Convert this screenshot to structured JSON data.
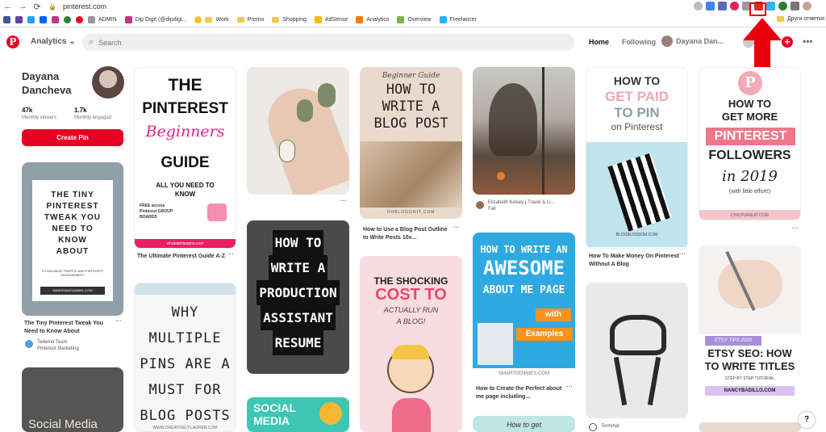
{
  "browser": {
    "url": "pinterest.com",
    "bookmarks": [
      "ADMIN",
      "Dip Digit (@dipdigi...",
      "Work",
      "Promo",
      "Shopping",
      "AdSense",
      "Analytics",
      "Overview",
      "Freelancer"
    ],
    "other_bookmarks": "Други отметки"
  },
  "header": {
    "analytics_label": "Analytics",
    "search_placeholder": "Search",
    "home_label": "Home",
    "following_label": "Following",
    "user_name": "Dayana Dan..."
  },
  "profile": {
    "name_line1": "Dayana",
    "name_line2": "Dancheva",
    "viewers_value": "47k",
    "viewers_label": "Monthly viewers",
    "engaged_value": "1.7k",
    "engaged_label": "Monthly engaged",
    "create_pin_label": "Create Pin"
  },
  "pins": {
    "p1": {
      "l1": "THE TINY",
      "l2": "PINTEREST",
      "l3": "TWEAK YOU",
      "l4": "NEED TO",
      "l5": "KNOW",
      "l6": "ABOUT",
      "sub": "TO MAXIMIZE TRAFFIC AND PINTEREST ENGAGEMENT!",
      "foot": "MARISSAMCDANIEL.COM",
      "title": "The Tiny Pinterest Tweak You Need to Know About",
      "src_name": "Tailwind Team",
      "src_sub": "Pinterest Marketing"
    },
    "p2": {
      "l1": "THE",
      "l2": "PINTEREST",
      "l3": "Beginners",
      "l4": "GUIDE",
      "l5": "ALL YOU NEED TO",
      "l6": "KNOW",
      "l7": "FREE access",
      "l8": "Pinterest GROUP",
      "l9": "BOARDS",
      "foot": "whatsbetterpins.com",
      "title": "The Ultimate Pinterest Guide A-Z"
    },
    "p3": {
      "l1": "WHY",
      "l2": "MULTIPLE",
      "l3": "PINS ARE A",
      "l4": "MUST FOR",
      "l5": "BLOG POSTS",
      "foot": "WWW.CREATIVELY-LAUREN.COM"
    },
    "p4": {
      "l1": "HOW TO",
      "l2": "WRITE A",
      "l3": "PRODUCTION",
      "l4": "ASSISTANT",
      "l5": "RESUME"
    },
    "p5": {
      "l1": "SOCIAL",
      "l2": "MEDIA"
    },
    "p6": {
      "l1": "Beginner Guide",
      "l2": "HOW TO",
      "l3": "WRITE A",
      "l4": "BLOG POST",
      "foot": "OHBLOGONIT.COM",
      "title": "How to Use a Blog Post Outline to Write Posts 10x..."
    },
    "p7": {
      "l1": "THE SHOCKING",
      "l2": "COST TO",
      "l3": "ACTUALLY RUN",
      "l4": "A BLOG!"
    },
    "p8": {
      "src_name": "Elizabeth Kelsey | Travel & Li...",
      "src_sub": "Fall"
    },
    "p9": {
      "l1": "HOW TO WRITE AN",
      "l2": "AWESOME",
      "l3": "ABOUT ME PAGE",
      "l4": "with",
      "l5": "Examples",
      "foot": "SMARTPENNIES.COM",
      "title": "How to Create the Perfect about me page including..."
    },
    "p10": {
      "l1": "How to get"
    },
    "p11": {
      "l1": "HOW TO",
      "l2": "GET PAID",
      "l3": "TO PIN",
      "l4": "on Pinterest",
      "foot": "BLOGBLOSSOM.COM",
      "title": "How To Make Money On Pinterest Without A Blog"
    },
    "p12": {
      "src_name": "Terminal"
    },
    "p13": {
      "l1": "HOW TO",
      "l2": "GET MORE",
      "l3": "PINTEREST",
      "l4": "FOLLOWERS",
      "l5": "in 2019",
      "l6": "(with little effort!)",
      "foot": "CHICPURSUIT.COM"
    },
    "p14": {
      "l1": "ETSY TIPS 2020",
      "l2": "ETSY SEO: HOW",
      "l3": "TO WRITE TITLES",
      "l4": "STEP BY STEP TUTORIAL",
      "foot": "NANCYBADILLO.COM"
    },
    "p15": {
      "l1": "Social Media"
    }
  },
  "colors": {
    "brand": "#e60023",
    "arrow": "#e8000b"
  }
}
